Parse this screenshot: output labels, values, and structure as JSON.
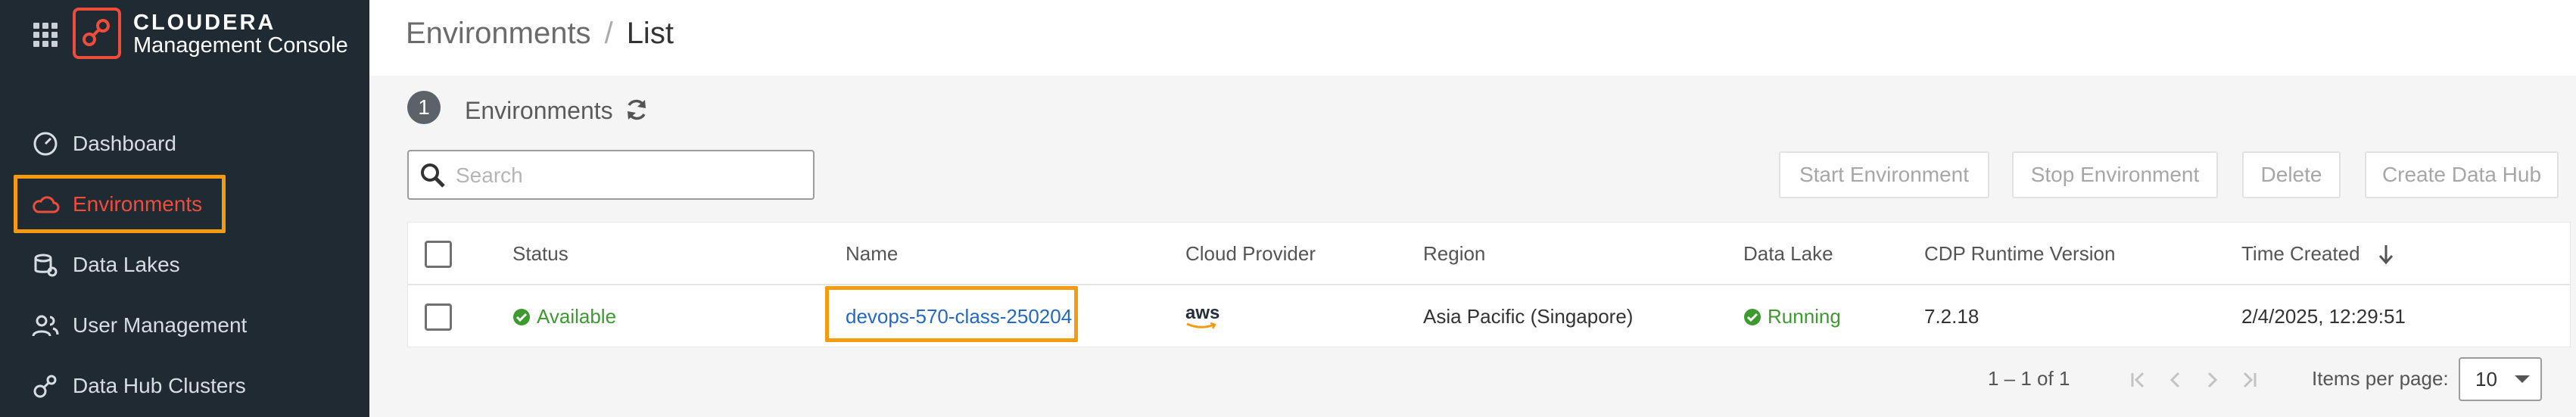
{
  "app": {
    "brand_name": "CLOUDERA",
    "brand_subtitle": "Management Console"
  },
  "sidebar": {
    "items": [
      {
        "label": "Dashboard",
        "icon": "dashboard-gauge-icon",
        "active": false
      },
      {
        "label": "Environments",
        "icon": "cloud-icon",
        "active": true
      },
      {
        "label": "Data Lakes",
        "icon": "data-lakes-icon",
        "active": false
      },
      {
        "label": "User Management",
        "icon": "users-icon",
        "active": false
      },
      {
        "label": "Data Hub Clusters",
        "icon": "clusters-icon",
        "active": false
      }
    ]
  },
  "header": {
    "breadcrumb_root": "Environments",
    "breadcrumb_separator": "/",
    "breadcrumb_current": "List"
  },
  "environments": {
    "count": "1",
    "title": "Environments",
    "search_placeholder": "Search",
    "actions": {
      "start": "Start Environment",
      "stop": "Stop Environment",
      "delete": "Delete",
      "create_data_hub": "Create Data Hub"
    }
  },
  "table": {
    "columns": [
      "Status",
      "Name",
      "Cloud Provider",
      "Region",
      "Data Lake",
      "CDP Runtime Version",
      "Time Created"
    ],
    "sort_column": "Time Created",
    "sort_direction": "descending",
    "rows": [
      {
        "status": "Available",
        "name": "devops-570-class-250204",
        "cloud_provider": "aws",
        "region": "Asia Pacific (Singapore)",
        "data_lake": "Running",
        "cdp_runtime_version": "7.2.18",
        "time_created": "2/4/2025, 12:29:51"
      }
    ]
  },
  "pagination": {
    "range": "1 – 1 of 1",
    "items_per_page_label": "Items per page:",
    "items_per_page": "10"
  },
  "colors": {
    "sidebar_bg": "#1f2a33",
    "brand_accent": "#ef4d3c",
    "highlight": "#f39c12",
    "success": "#3c9a2f",
    "link": "#2568c4"
  }
}
